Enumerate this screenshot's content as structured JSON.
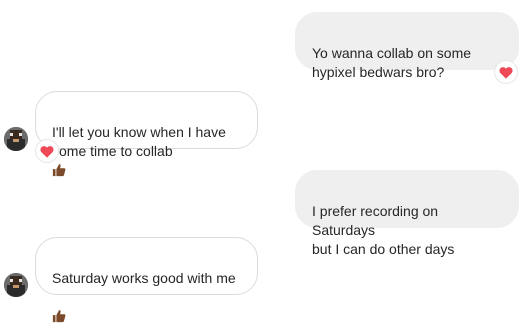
{
  "thread": {
    "messages": [
      {
        "direction": "sent",
        "text": "Yo wanna collab on some\nhypixel bedwars bro?",
        "reaction": "heart-icon"
      },
      {
        "direction": "received",
        "text": "I'll let you know when I have\nsome time to collab",
        "emoji": "thumbs-up-icon",
        "reaction": "heart-icon"
      },
      {
        "direction": "sent",
        "text": "I prefer recording on Saturdays\nbut I can do other days"
      },
      {
        "direction": "received",
        "text": "Saturday works good with me",
        "emoji": "thumbs-up-icon"
      }
    ]
  },
  "colors": {
    "sent_bubble": "#efefef",
    "received_border": "#dbdbdb",
    "heart": "#ed4956",
    "thumb": "#7a4a2a"
  }
}
